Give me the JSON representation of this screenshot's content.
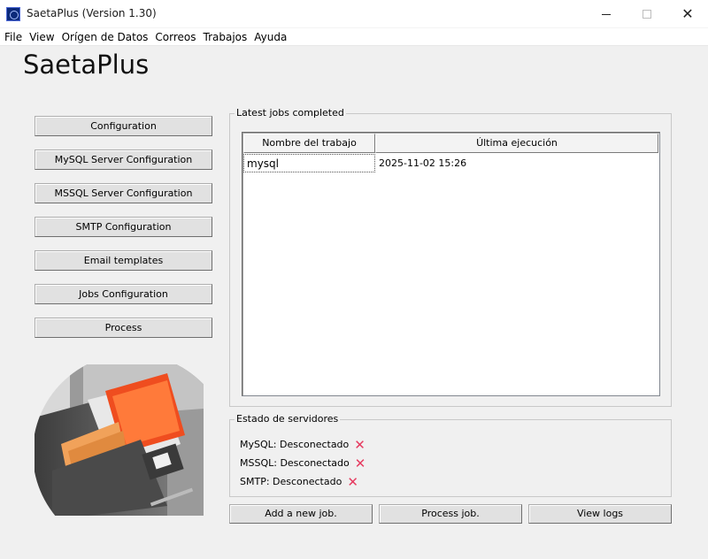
{
  "window": {
    "title": "SaetaPlus (Version 1.30)",
    "controls": {
      "minimize": "minimize-icon",
      "maximize": "maximize-icon",
      "close": "✕"
    }
  },
  "menu": [
    "File",
    "View",
    "Orígen de Datos",
    "Correos",
    "Trabajos",
    "Ayuda"
  ],
  "app_title": "SaetaPlus",
  "sidebar": {
    "buttons": [
      "Configuration",
      "MySQL Server Configuration",
      "MSSQL Server Configuration",
      "SMTP Configuration",
      "Email templates",
      "Jobs Configuration",
      "Process"
    ]
  },
  "jobs_group": {
    "legend": "Latest jobs completed",
    "columns": [
      "Nombre del trabajo",
      "Última ejecución"
    ],
    "rows": [
      {
        "name": "mysql",
        "last_run": "2025-11-02 15:26"
      }
    ]
  },
  "servers_group": {
    "legend": "Estado de servidores",
    "lines": [
      {
        "text": "MySQL: Desconectado",
        "icon": "x-icon"
      },
      {
        "text": "MSSQL: Desconectado",
        "icon": "x-icon"
      },
      {
        "text": "SMTP: Desconectado",
        "icon": "x-icon"
      }
    ],
    "status_color": "#e63a5f"
  },
  "actions": [
    "Add a new job.",
    "Process job.",
    "View logs"
  ]
}
